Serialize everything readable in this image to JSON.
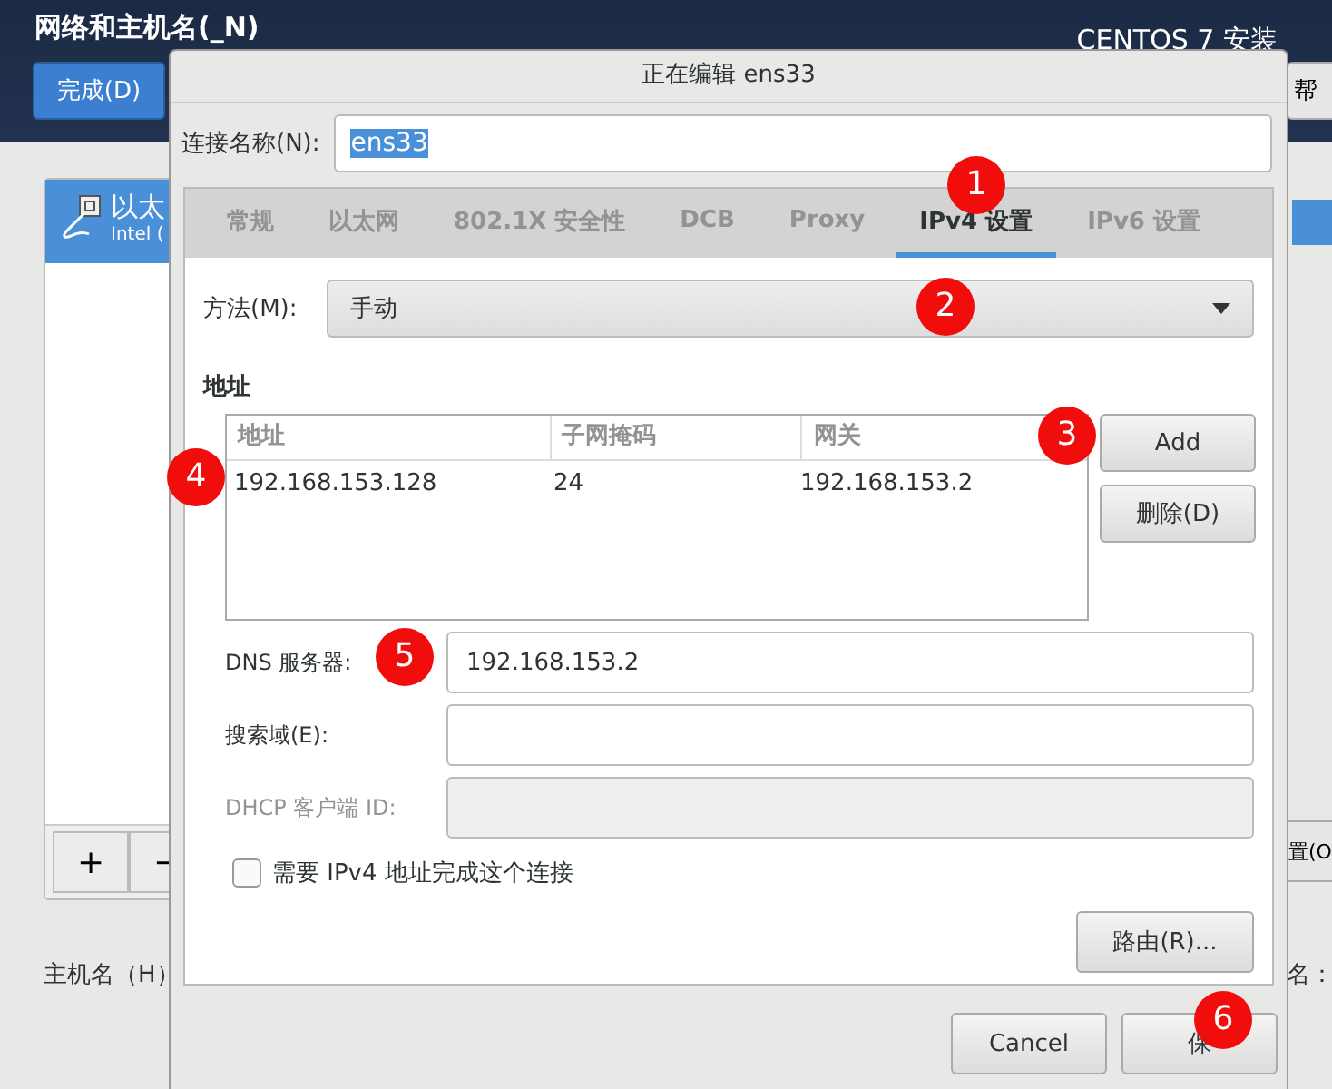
{
  "background": {
    "title": "网络和主机名(_N)",
    "product": "CENTOS 7 安装",
    "done_button": "完成(D)",
    "help_button": "帮",
    "connection": {
      "name": "以太",
      "detail": "Intel (",
      "selected": true
    },
    "add_button": "+",
    "remove_button": "−",
    "switch_on": true,
    "configure_button": "置(O",
    "hostname_label": "主机名（H）",
    "right_label": "名："
  },
  "dialog": {
    "title": "正在编辑 ens33",
    "name_label": "连接名称(N):",
    "name_value": "ens33",
    "name_value_selected": true,
    "tabs": [
      {
        "label": "常规",
        "selected": false
      },
      {
        "label": "以太网",
        "selected": false
      },
      {
        "label": "802.1X 安全性",
        "selected": false
      },
      {
        "label": "DCB",
        "selected": false
      },
      {
        "label": "Proxy",
        "selected": false
      },
      {
        "label": "IPv4 设置",
        "selected": true
      },
      {
        "label": "IPv6 设置",
        "selected": false
      }
    ],
    "method_label": "方法(M):",
    "method_value": "手动",
    "section_title": "地址",
    "table": {
      "columns": [
        "地址",
        "子网掩码",
        "网关"
      ],
      "rows": [
        [
          "192.168.153.128",
          "24",
          "192.168.153.2"
        ]
      ]
    },
    "add_button": "Add",
    "delete_button": "删除(D)",
    "fields": [
      {
        "label": "DNS 服务器:",
        "value": "192.168.153.2",
        "disabled": false
      },
      {
        "label": "搜索域(E):",
        "disabled": false
      },
      {
        "label": "DHCP 客户端 ID:",
        "disabled": true
      }
    ],
    "checkbox": {
      "label": "需要 IPv4 地址完成这个连接",
      "checked": false
    },
    "routes_button": "路由(R)...",
    "cancel_button": "Cancel",
    "save_button": "保"
  },
  "markers": [
    {
      "text": "1"
    },
    {
      "text": "2"
    },
    {
      "text": "3"
    },
    {
      "text": "4"
    },
    {
      "text": "5"
    },
    {
      "text": "6"
    }
  ]
}
